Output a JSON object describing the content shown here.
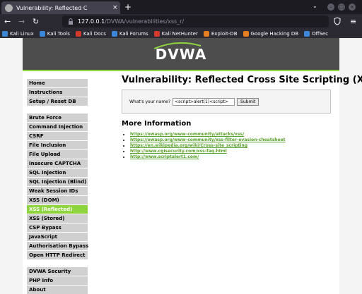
{
  "browser": {
    "tab_title": "Vulnerability: Reflected C",
    "tab_close": "×",
    "new_tab": "+",
    "url_host": "127.0.0.1",
    "url_path": "/DVWA/vulnerabilities/xss_r/",
    "icons": [
      "back-icon",
      "forward-icon",
      "reload-icon",
      "lock-icon",
      "shield-icon",
      "menu-icon",
      "tab-list-icon"
    ],
    "colors": {
      "tab_bar": "#1c1b22",
      "toolbar": "#2b2a33",
      "text": "#fbfbfe"
    }
  },
  "bookmarks": [
    {
      "label": "Kali Linux",
      "color": "#3b86d8"
    },
    {
      "label": "Kali Tools",
      "color": "#3b86d8"
    },
    {
      "label": "Kali Docs",
      "color": "#d33a2c"
    },
    {
      "label": "Kali Forums",
      "color": "#3b86d8"
    },
    {
      "label": "Kali NetHunter",
      "color": "#d33a2c"
    },
    {
      "label": "Exploit-DB",
      "color": "#e67e22"
    },
    {
      "label": "Google Hacking DB",
      "color": "#e67e22"
    },
    {
      "label": "OffSec",
      "color": "#3b86d8"
    }
  ],
  "dvwa": {
    "logo": "DVWA",
    "accent": "#8ed43f",
    "menu_groups": [
      [
        "Home",
        "Instructions",
        "Setup / Reset DB"
      ],
      [
        "Brute Force",
        "Command Injection",
        "CSRF",
        "File Inclusion",
        "File Upload",
        "Insecure CAPTCHA",
        "SQL Injection",
        "SQL Injection (Blind)",
        "Weak Session IDs",
        "XSS (DOM)",
        "XSS (Reflected)",
        "XSS (Stored)",
        "CSP Bypass",
        "JavaScript",
        "Authorisation Bypass",
        "Open HTTP Redirect"
      ],
      [
        "DVWA Security",
        "PHP Info",
        "About"
      ]
    ],
    "active_item": "XSS (Reflected)",
    "page_title": "Vulnerability: Reflected Cross Site Scripting (XSS)",
    "form": {
      "label": "What's your name?",
      "input_value": "<script>alert(1)<script>",
      "submit_label": "Submit"
    },
    "more_info_heading": "More Information",
    "links": [
      "https://owasp.org/www-community/attacks/xss/",
      "https://owasp.org/www-community/xss-filter-evasion-cheatsheet",
      "https://en.wikipedia.org/wiki/Cross-site_scripting",
      "http://www.cgisecurity.com/xss-faq.html",
      "http://www.scriptalert1.com/"
    ]
  }
}
